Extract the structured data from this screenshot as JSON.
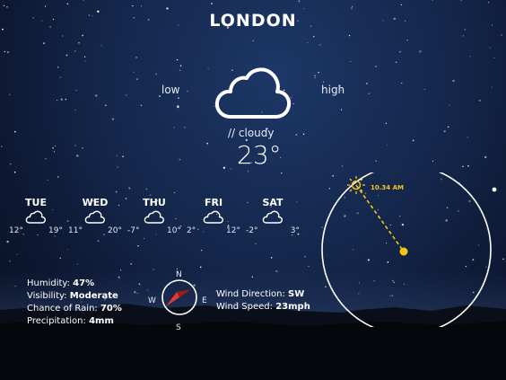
{
  "city": "LONDON",
  "range_labels": {
    "low": "low",
    "high": "high"
  },
  "current": {
    "condition": "// cloudy",
    "temp": "23°",
    "icon": "cloud-icon"
  },
  "forecast": [
    {
      "day": "TUE",
      "low": "12°",
      "high": "19°",
      "icon": "cloud-icon"
    },
    {
      "day": "WED",
      "low": "11°",
      "high": "20°",
      "icon": "cloud-icon"
    },
    {
      "day": "THU",
      "low": "-7°",
      "high": "10°",
      "icon": "cloud-icon"
    },
    {
      "day": "FRI",
      "low": "2°",
      "high": "12°",
      "icon": "cloud-icon"
    },
    {
      "day": "SAT",
      "low": "-2°",
      "high": "3°",
      "icon": "cloud-icon"
    }
  ],
  "details": {
    "humidity_label": "Humidity:",
    "humidity": "47%",
    "visibility_label": "Visibility:",
    "visibility": "Moderate",
    "rain_label": "Chance of Rain:",
    "rain": "70%",
    "precip_label": "Precipitation:",
    "precip": "4mm"
  },
  "wind": {
    "direction_label": "Wind Direction:",
    "direction": "SW",
    "speed_label": "Wind Speed:",
    "speed": "23mph",
    "compass": {
      "n": "N",
      "s": "S",
      "e": "E",
      "w": "W"
    }
  },
  "sun": {
    "time": "10.34 AM",
    "icon": "sun-icon"
  },
  "colors": {
    "accent": "#f5c518",
    "compass_needle": "#e53935"
  }
}
